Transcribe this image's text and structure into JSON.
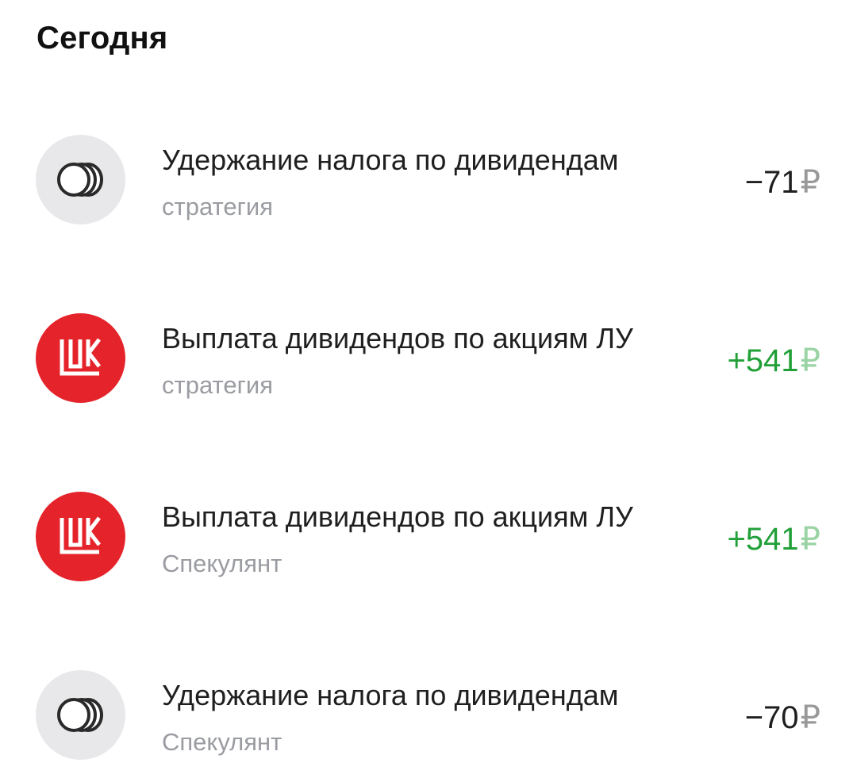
{
  "section": {
    "title": "Сегодня"
  },
  "operations": [
    {
      "icon": "coins-icon",
      "title": "Удержание налога по дивидендам",
      "subtitle": "стратегия",
      "amount": "−71",
      "currency": "₽",
      "type": "debit"
    },
    {
      "icon": "lukoil-logo-icon",
      "title": "Выплата дивидендов по акциям ЛУ",
      "subtitle": "стратегия",
      "amount": "+541",
      "currency": "₽",
      "type": "credit"
    },
    {
      "icon": "lukoil-logo-icon",
      "title": "Выплата дивидендов по акциям ЛУ",
      "subtitle": "Спекулянт",
      "amount": "+541",
      "currency": "₽",
      "type": "credit"
    },
    {
      "icon": "coins-icon",
      "title": "Удержание налога по дивидендам",
      "subtitle": "Спекулянт",
      "amount": "−70",
      "currency": "₽",
      "type": "debit"
    }
  ],
  "colors": {
    "credit": "#21a038",
    "debit": "#1f1f1f",
    "subtitle": "#9a9ca1",
    "icon_bg_grey": "#e8e8ea",
    "lukoil_red": "#e5232a"
  }
}
